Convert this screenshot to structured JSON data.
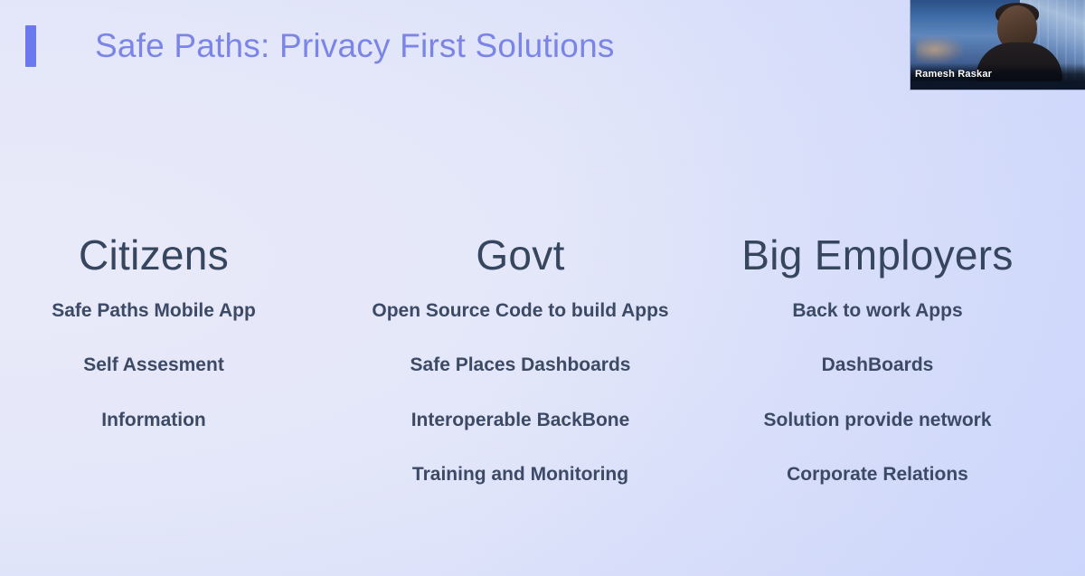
{
  "slide": {
    "title": "Safe Paths: Privacy First Solutions",
    "accent_color": "#6b78ee",
    "title_color": "#7b85e8",
    "heading_color": "#36465e",
    "item_color": "#3c4a66",
    "background_from": "#e9eaf9",
    "background_to": "#ccd4fb"
  },
  "columns": [
    {
      "heading": "Citizens",
      "items": [
        "Safe Paths Mobile App",
        "Self Assesment",
        "Information"
      ]
    },
    {
      "heading": "Govt",
      "items": [
        "Open Source Code to build Apps",
        "Safe Places Dashboards",
        "Interoperable BackBone",
        "Training and Monitoring"
      ]
    },
    {
      "heading": "Big Employers",
      "items": [
        "Back to work Apps",
        "DashBoards",
        "Solution provide network",
        "Corporate Relations"
      ]
    }
  ],
  "video": {
    "speaker_name": "Ramesh Raskar"
  }
}
